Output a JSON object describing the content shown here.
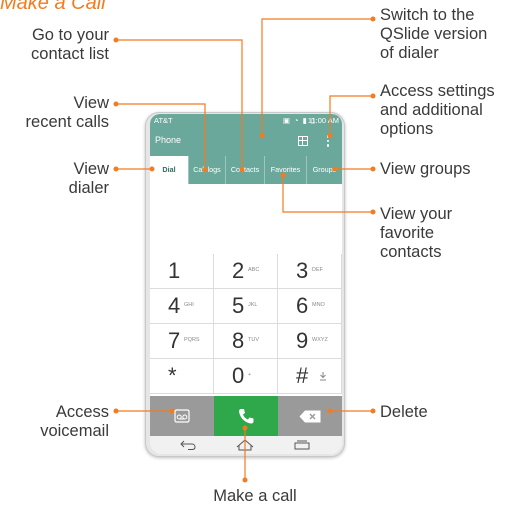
{
  "title": "Make a Call",
  "callouts": {
    "contacts_list": [
      "Go to your",
      "contact list"
    ],
    "qslide": [
      "Switch to the",
      "QSlide version",
      "of dialer"
    ],
    "recent_calls": [
      "View",
      "recent calls"
    ],
    "settings": [
      "Access settings",
      "and additional",
      "options"
    ],
    "dialer": [
      "View",
      "dialer"
    ],
    "groups": [
      "View groups"
    ],
    "favorites": [
      "View your",
      "favorite",
      "contacts"
    ],
    "voicemail": [
      "Access",
      "voicemail"
    ],
    "delete": [
      "Delete"
    ],
    "make_call": [
      "Make a call"
    ]
  },
  "phone": {
    "carrier": "AT&T",
    "time": "11:00 AM",
    "app_title": "Phone",
    "tabs": [
      "Dial",
      "Call logs",
      "Contacts",
      "Favorites",
      "Groups"
    ],
    "keys": [
      {
        "digit": "1",
        "letters": ""
      },
      {
        "digit": "2",
        "letters": "ABC"
      },
      {
        "digit": "3",
        "letters": "DEF"
      },
      {
        "digit": "4",
        "letters": "GHI"
      },
      {
        "digit": "5",
        "letters": "JKL"
      },
      {
        "digit": "6",
        "letters": "MNO"
      },
      {
        "digit": "7",
        "letters": "PQRS"
      },
      {
        "digit": "8",
        "letters": "TUV"
      },
      {
        "digit": "9",
        "letters": "WXYZ"
      },
      {
        "digit": "*",
        "letters": ""
      },
      {
        "digit": "0",
        "letters": "+"
      },
      {
        "digit": "#",
        "letters": ""
      }
    ]
  },
  "colors": {
    "title": "#f47b20",
    "callout_line": "#f47b20",
    "header": "#6aa89c",
    "call_button": "#2ea84a",
    "action_bar": "#9a9a9a"
  },
  "icons": [
    "qslide-icon",
    "menu-icon",
    "voicemail-icon",
    "phone-icon",
    "delete-icon",
    "back-icon",
    "home-icon",
    "recent-apps-icon",
    "signal-icon",
    "wifi-icon",
    "battery-icon",
    "nfc-icon"
  ]
}
